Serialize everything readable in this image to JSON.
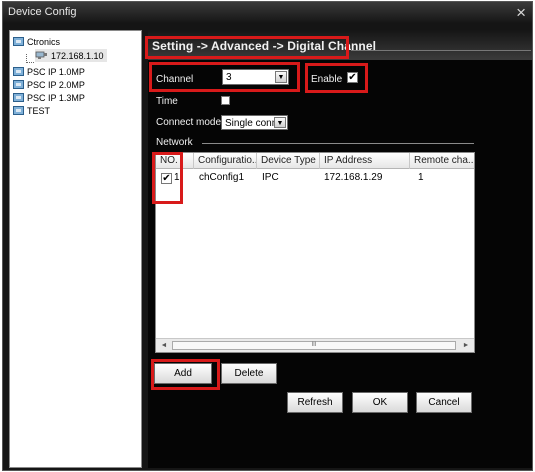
{
  "window": {
    "title": "Device Config",
    "close_glyph": "×"
  },
  "tree": {
    "items": [
      {
        "label": "Ctronics",
        "icon": "folder-icon"
      },
      {
        "label": "172.168.1.10",
        "icon": "device-icon"
      },
      {
        "label": "PSC IP 1.0MP",
        "icon": "folder-icon"
      },
      {
        "label": "PSC IP 2.0MP",
        "icon": "folder-icon"
      },
      {
        "label": "PSC IP 1.3MP",
        "icon": "folder-icon"
      },
      {
        "label": "TEST",
        "icon": "folder-icon"
      }
    ]
  },
  "breadcrumb": "Setting -> Advanced -> Digital Channel",
  "form": {
    "channel_label": "Channel",
    "channel_value": "3",
    "enable_label": "Enable",
    "enable_checked": "✔",
    "time_label": "Time",
    "connect_mode_label": "Connect mode",
    "connect_mode_value": "Single connec",
    "network_label": "Network"
  },
  "table": {
    "columns": [
      "NO.",
      "Configuratio...",
      "Device Type",
      "IP Address",
      "Remote cha..."
    ],
    "rows": [
      {
        "checked": "✔",
        "no": "1",
        "config": "chConfig1",
        "device_type": "IPC",
        "ip": "172.168.1.29",
        "remote_channel": "1"
      }
    ],
    "scroll_left": "◄",
    "scroll_right": "►",
    "scroll_thumb": "III"
  },
  "buttons": {
    "add": "Add",
    "delete": "Delete",
    "refresh": "Refresh",
    "ok": "OK",
    "cancel": "Cancel"
  },
  "combo_arrow": "▼",
  "colors": {
    "highlight": "#d81a1a",
    "panel_bg": "#050505",
    "window_bg": "#151515"
  }
}
